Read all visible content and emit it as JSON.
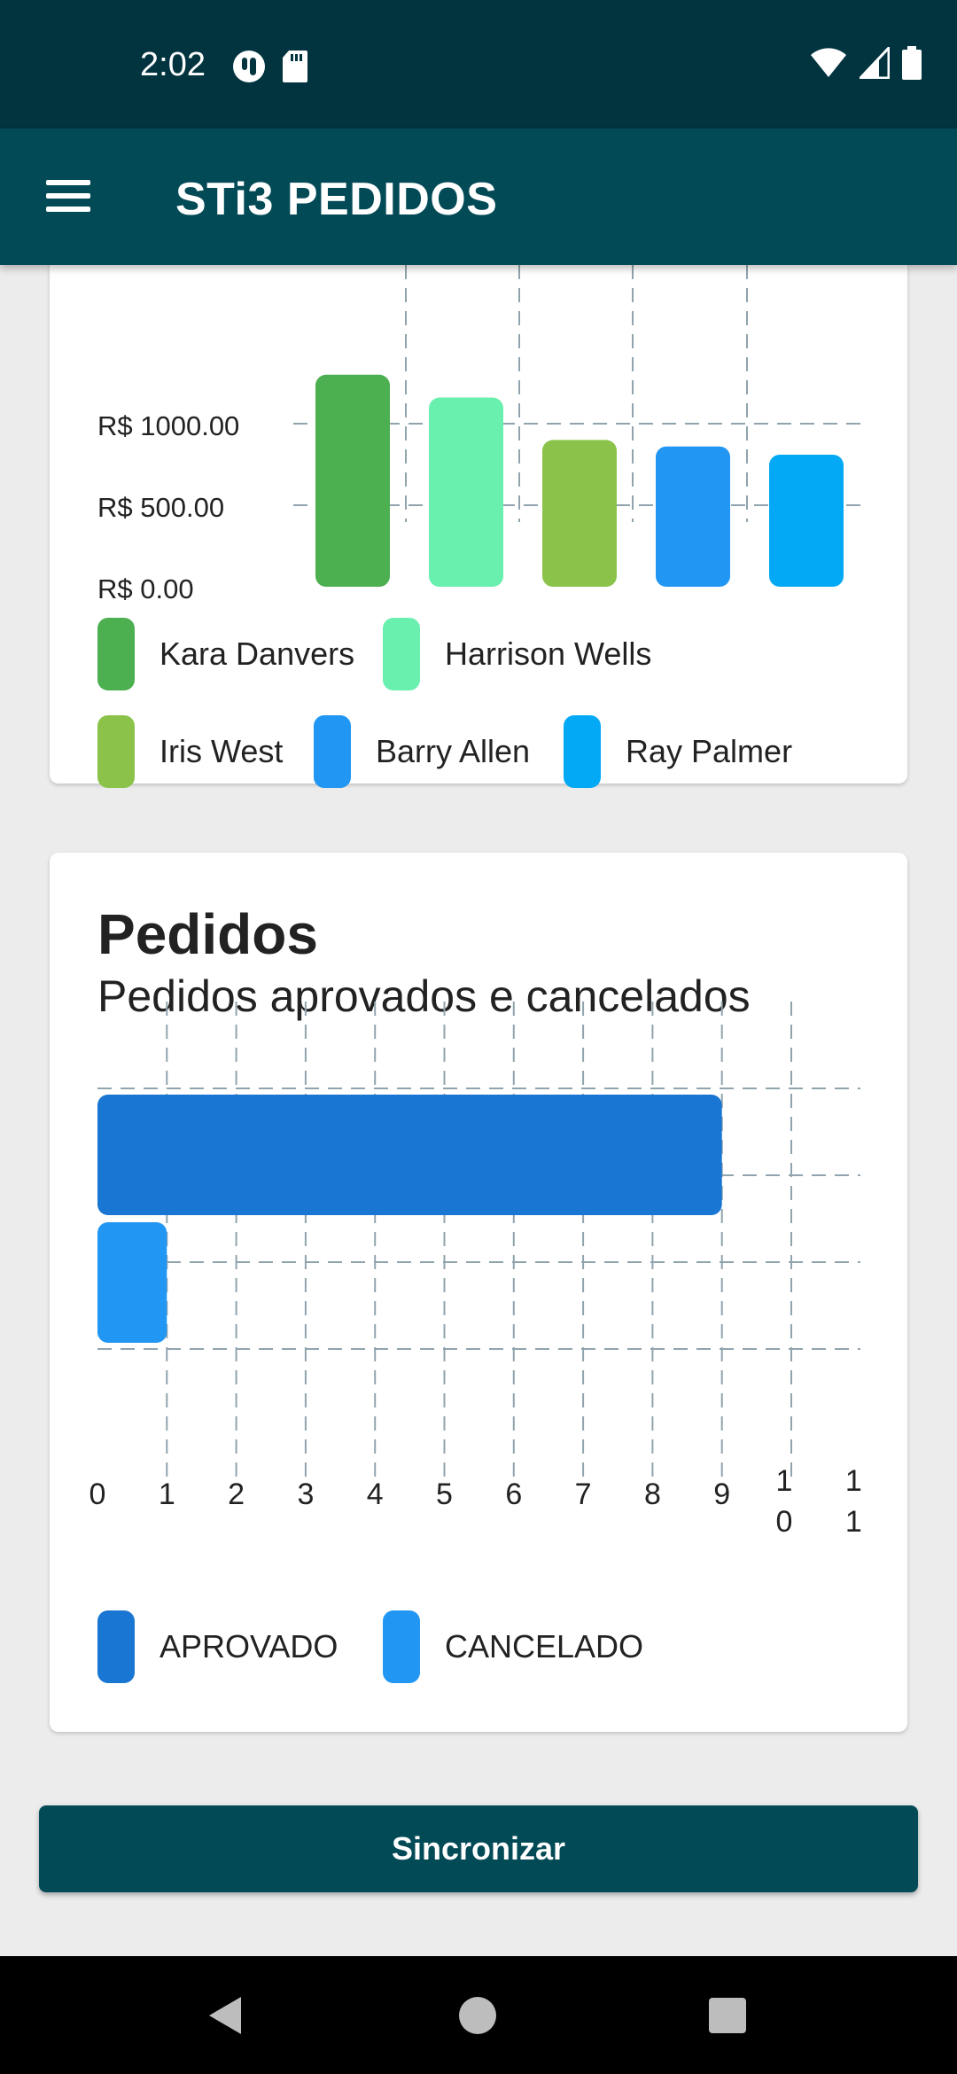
{
  "status_bar": {
    "time": "2:02",
    "left_icons": [
      "app-notification-icon",
      "sd-card-icon"
    ],
    "right_icons": [
      "wifi-icon",
      "cell-signal-icon",
      "battery-icon"
    ]
  },
  "app_bar": {
    "menu_icon": "hamburger-menu-icon",
    "title": "STi3 PEDIDOS"
  },
  "vendors_card": {
    "legend": [
      {
        "label": "Kara Danvers",
        "color": "#4caf50"
      },
      {
        "label": "Harrison Wells",
        "color": "#69f0ae"
      },
      {
        "label": "Iris West",
        "color": "#8bc34a"
      },
      {
        "label": "Barry Allen",
        "color": "#2196f3"
      },
      {
        "label": "Ray Palmer",
        "color": "#03a9f4"
      }
    ]
  },
  "orders_card": {
    "title": "Pedidos",
    "subtitle": "Pedidos aprovados e cancelados",
    "legend": [
      {
        "label": "APROVADO",
        "color": "#1976d2"
      },
      {
        "label": "CANCELADO",
        "color": "#2196f3"
      }
    ]
  },
  "chart_data": [
    {
      "type": "bar",
      "categories": [
        "Kara Danvers",
        "Harrison Wells",
        "Iris West",
        "Barry Allen",
        "Ray Palmer"
      ],
      "values": [
        1300,
        1160,
        900,
        860,
        810
      ],
      "ytick_labels": [
        "R$ 0.00",
        "R$ 500.00",
        "R$ 1000.00"
      ],
      "ytick_values": [
        0,
        500,
        1000
      ],
      "ylim": [
        0,
        1300
      ],
      "grid": true,
      "legend_position": "bottom",
      "colors": [
        "#4caf50",
        "#69f0ae",
        "#8bc34a",
        "#2196f3",
        "#03a9f4"
      ]
    },
    {
      "type": "bar",
      "orientation": "horizontal",
      "categories": [
        "APROVADO",
        "CANCELADO"
      ],
      "values": [
        9,
        1
      ],
      "xticks": [
        "0",
        "1",
        "2",
        "3",
        "4",
        "5",
        "6",
        "7",
        "8",
        "9",
        "10",
        "11"
      ],
      "xlim": [
        0,
        11
      ],
      "grid": true,
      "legend_position": "bottom",
      "colors": [
        "#1976d2",
        "#2196f3"
      ]
    }
  ],
  "sync_button": {
    "label": "Sincronizar"
  },
  "nav_bar": {
    "icons": [
      "back-icon",
      "home-icon",
      "recents-icon"
    ]
  }
}
